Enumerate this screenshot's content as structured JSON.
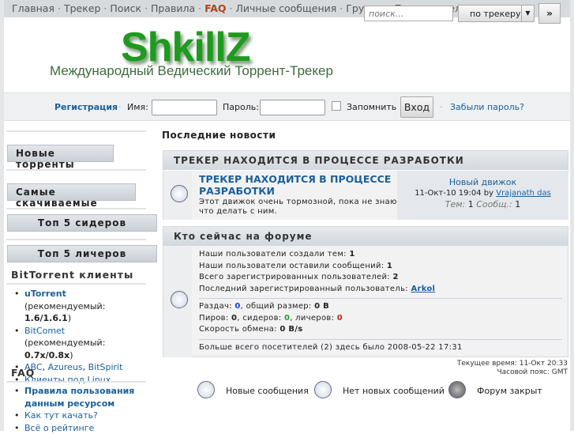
{
  "nav": {
    "items": [
      "Главная",
      "Трекер",
      "Поиск",
      "Правила",
      "FAQ",
      "Личные сообщения",
      "Группы",
      "Пользователи"
    ]
  },
  "search": {
    "placeholder": "поиск...",
    "scope": "по трекеру",
    "go": "»"
  },
  "logo": {
    "title": "ShkillZ",
    "tagline": "Международный Ведический Торрент-Трекер"
  },
  "login": {
    "register": "Регистрация",
    "name_label": "Имя:",
    "password_label": "Пароль:",
    "remember": "Запомнить",
    "submit": "Вход",
    "forgot": "Забыли пароль?"
  },
  "sidebar": {
    "buttons": [
      "Новые торренты",
      "Самые скачиваемые",
      "Топ 5 сидеров",
      "Топ 5 личеров"
    ],
    "clients_title": "BitTorrent клиенты",
    "utorrent": "uTorrent",
    "rec": "(рекомендуемый: ",
    "utorrent_ver": "1.6/1.6.1",
    "bitcomet": "BitComet",
    "bitcomet_ver": "0.7x/0.8x",
    "close": ")",
    "abc": "ABC",
    "azureus": "Azureus",
    "bitspirit": "BitSpirit",
    "linux": "Клиенты под Linux",
    "faq_title": "FAQ",
    "faq": [
      "Правила пользования данным ресурсом",
      "Как тут качать?",
      "Всё о рейтинге"
    ]
  },
  "news": {
    "title": "Последние новости",
    "category": "ТРЕКЕР НАХОДИТСЯ В ПРОЦЕССЕ РАЗРАБОТКИ",
    "topic": "ТРЕКЕР НАХОДИТСЯ В ПРОЦЕССЕ РАЗРАБОТКИ",
    "desc": "Этот движок очень тормозной, пока не знаю что делать с ним.",
    "last_post": "Новый движок",
    "date": "11-Окт-10 19:04",
    "by": "by",
    "author": "Vrajanath das",
    "topics_label": "Тем:",
    "topics": "1",
    "posts_label": "Сообщ.:",
    "posts": "1"
  },
  "stats": {
    "title": "Кто сейчас на форуме",
    "l1": "Наши пользователи создали тем: ",
    "v1": "1",
    "l2": "Наши пользователи оставили сообщений: ",
    "v2": "1",
    "l3": "Всего зарегистрированных пользователей: ",
    "v3": "2",
    "l4": "Последний зарегистрированный пользователь: ",
    "v4": "Arkol",
    "releases_label": "Раздач: ",
    "releases": "0",
    "size_label": ",  общий размер: ",
    "size": "0 B",
    "peers_label": "Пиров: ",
    "peers": "0",
    "seeders_label": ",  сидеров: ",
    "seeders": "0",
    "leechers_label": ",  личеров: ",
    "leechers": "0",
    "speed_label": "Скорость обмена: ",
    "speed": "0 B/s",
    "record": "Больше всего посетителей (2) здесь было 2008-05-22 17:31"
  },
  "footer": {
    "time": "Текущее время: 11-Окт  20:33",
    "tz": "Часовой пояс: GMT"
  },
  "legend": [
    "Новые сообщения",
    "Нет новых сообщений",
    "Форум закрыт"
  ],
  "colors": {
    "link": "#1a5f9a",
    "logo": "#1e9a1e",
    "faq": "#b0441a",
    "blue": "#1a3fe0",
    "green": "#2a9a2a",
    "red": "#c0281e"
  }
}
